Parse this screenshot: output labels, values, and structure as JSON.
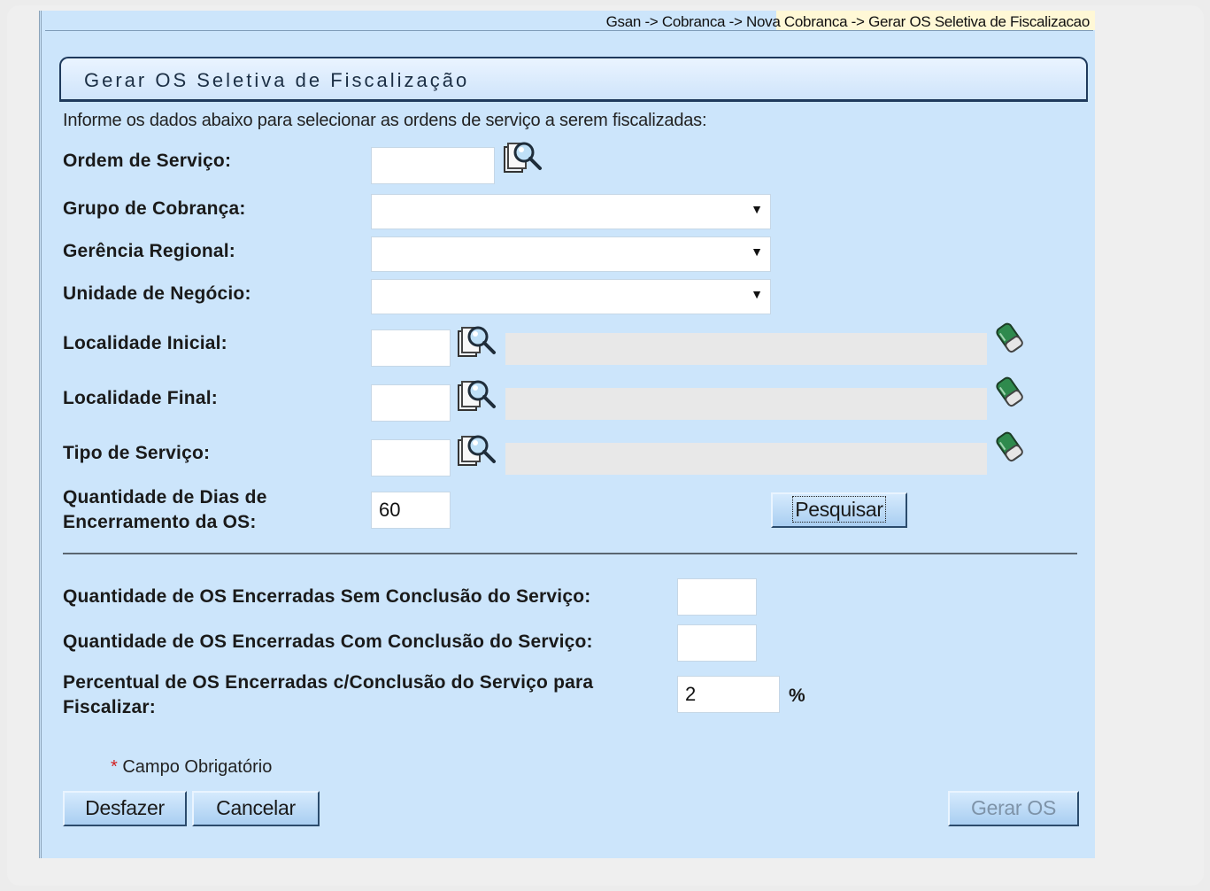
{
  "breadcrumb": "Gsan -> Cobranca -> Nova Cobranca -> Gerar OS Seletiva de Fiscalizacao",
  "form_title": "Gerar OS Seletiva de Fiscalização",
  "intro": "Informe os dados abaixo para selecionar as ordens de serviço a serem fiscalizadas:",
  "fields": {
    "ordem_servico": {
      "label": "Ordem de Serviço:",
      "value": ""
    },
    "grupo_cobranca": {
      "label": "Grupo de Cobrança:",
      "value": ""
    },
    "gerencia_regional": {
      "label": "Gerência Regional:",
      "value": ""
    },
    "unidade_negocio": {
      "label": "Unidade de Negócio:",
      "value": ""
    },
    "localidade_inicial": {
      "label": "Localidade Inicial:",
      "value": "",
      "description": ""
    },
    "localidade_final": {
      "label": "Localidade Final:",
      "value": "",
      "description": ""
    },
    "tipo_servico": {
      "label": "Tipo de Serviço:",
      "value": "",
      "description": ""
    },
    "dias_encerramento": {
      "label_line1": "Quantidade de Dias de",
      "label_line2": "Encerramento da OS:",
      "value": "60"
    },
    "qtd_sem_conclusao": {
      "label": "Quantidade de OS Encerradas Sem Conclusão do Serviço:",
      "value": ""
    },
    "qtd_com_conclusao": {
      "label": "Quantidade de OS Encerradas Com Conclusão do Serviço:",
      "value": ""
    },
    "percentual": {
      "label_line1": "Percentual de OS Encerradas c/Conclusão do Serviço para",
      "label_line2": "Fiscalizar:",
      "value": "2",
      "unit": "%"
    }
  },
  "buttons": {
    "pesquisar": "Pesquisar",
    "desfazer": "Desfazer",
    "cancelar": "Cancelar",
    "gerar_os": "Gerar OS"
  },
  "required_note": {
    "star": "*",
    "text": " Campo Obrigatório"
  },
  "icons": {
    "search": "magnifier-icon",
    "clear": "eraser-icon"
  }
}
